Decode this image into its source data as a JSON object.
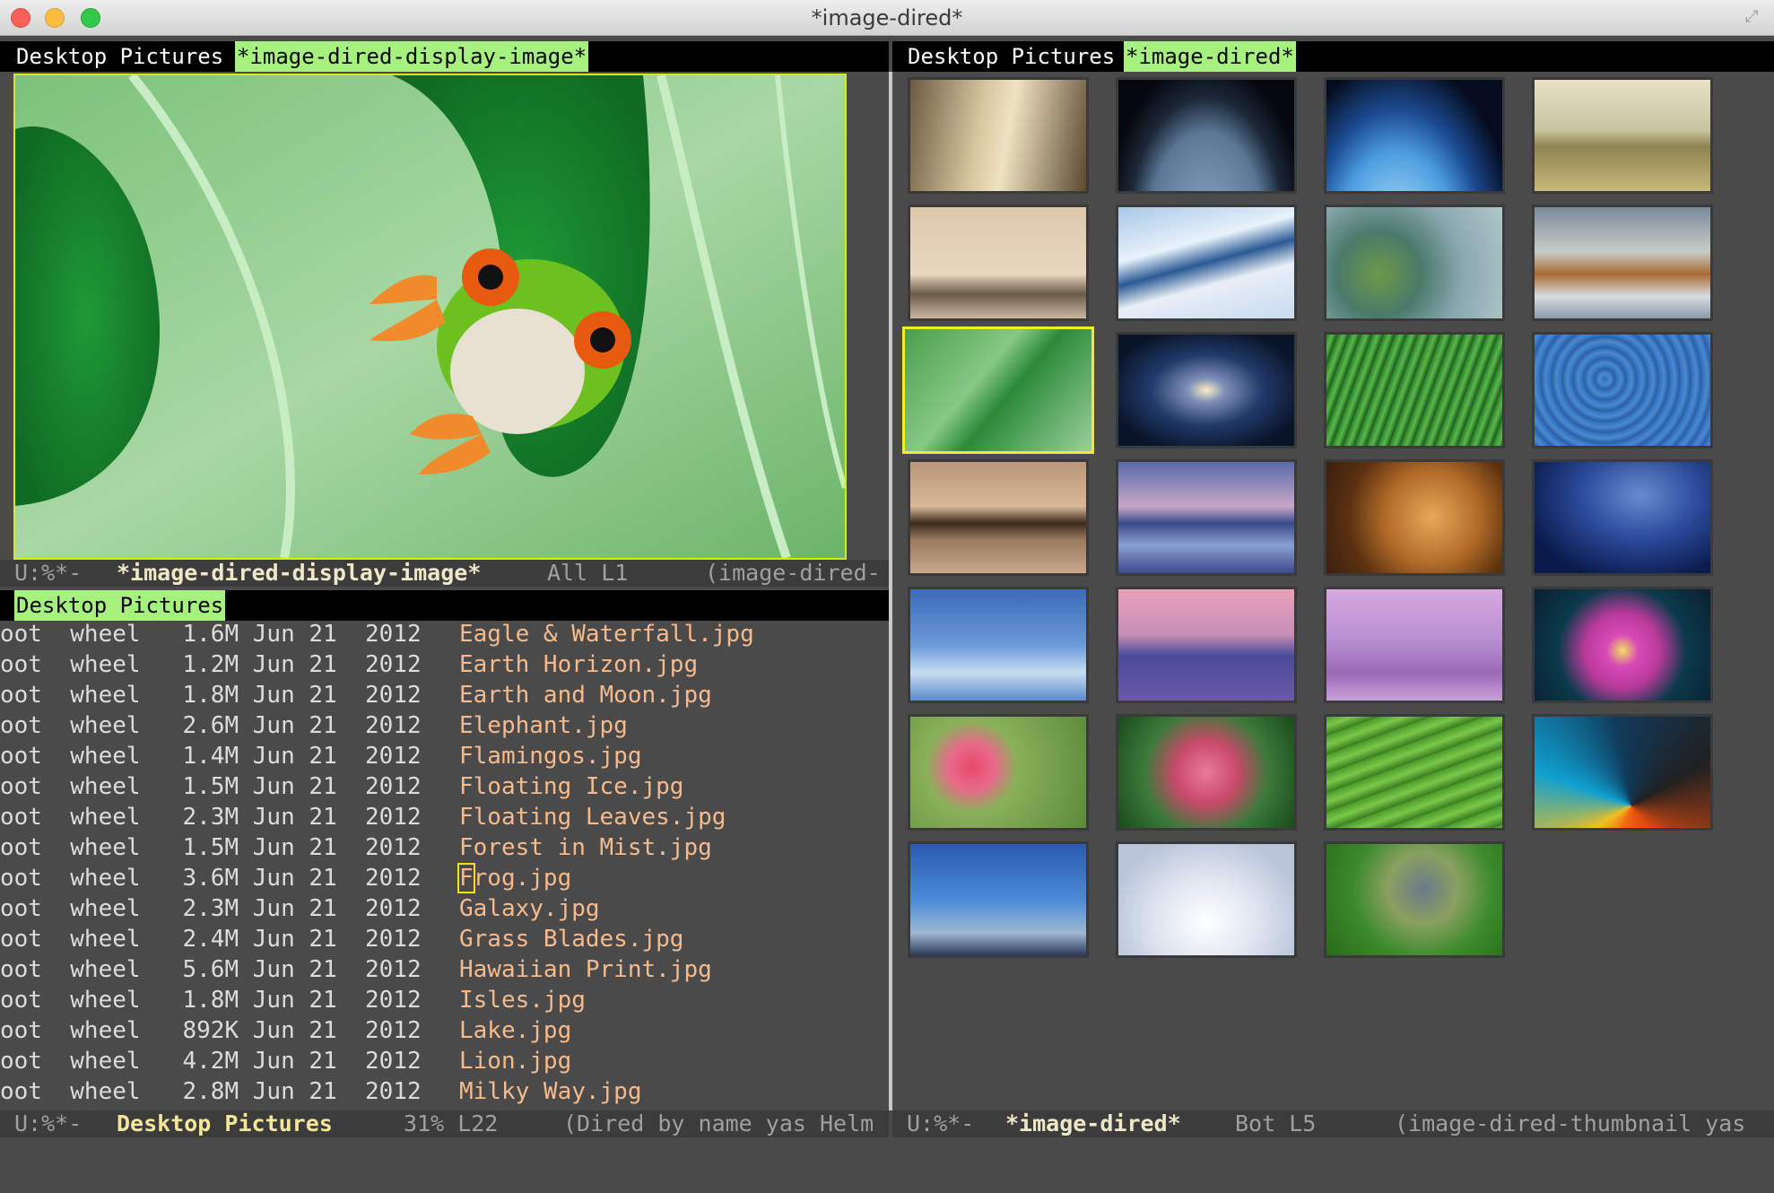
{
  "window": {
    "title": "*image-dired*"
  },
  "left_top_tabs": {
    "inactive": "Desktop Pictures",
    "active": "*image-dired-display-image*"
  },
  "right_tabs": {
    "inactive": "Desktop Pictures",
    "active": "*image-dired*"
  },
  "display_modeline": {
    "status": "U:%*-",
    "buffer": "*image-dired-display-image*",
    "position": "All L1",
    "mode": "(image-dired-"
  },
  "dired_header": "Desktop Pictures",
  "dired_rows": [
    {
      "meta": "oot  wheel   1.6M Jun 21  2012",
      "file": "Eagle & Waterfall.jpg"
    },
    {
      "meta": "oot  wheel   1.2M Jun 21  2012",
      "file": "Earth Horizon.jpg"
    },
    {
      "meta": "oot  wheel   1.8M Jun 21  2012",
      "file": "Earth and Moon.jpg"
    },
    {
      "meta": "oot  wheel   2.6M Jun 21  2012",
      "file": "Elephant.jpg"
    },
    {
      "meta": "oot  wheel   1.4M Jun 21  2012",
      "file": "Flamingos.jpg"
    },
    {
      "meta": "oot  wheel   1.5M Jun 21  2012",
      "file": "Floating Ice.jpg"
    },
    {
      "meta": "oot  wheel   2.3M Jun 21  2012",
      "file": "Floating Leaves.jpg"
    },
    {
      "meta": "oot  wheel   1.5M Jun 21  2012",
      "file": "Forest in Mist.jpg"
    },
    {
      "meta": "oot  wheel   3.6M Jun 21  2012",
      "file": "Frog.jpg"
    },
    {
      "meta": "oot  wheel   2.3M Jun 21  2012",
      "file": "Galaxy.jpg"
    },
    {
      "meta": "oot  wheel   2.4M Jun 21  2012",
      "file": "Grass Blades.jpg"
    },
    {
      "meta": "oot  wheel   5.6M Jun 21  2012",
      "file": "Hawaiian Print.jpg"
    },
    {
      "meta": "oot  wheel   1.8M Jun 21  2012",
      "file": "Isles.jpg"
    },
    {
      "meta": "oot  wheel   892K Jun 21  2012",
      "file": "Lake.jpg"
    },
    {
      "meta": "oot  wheel   4.2M Jun 21  2012",
      "file": "Lion.jpg"
    },
    {
      "meta": "oot  wheel   2.8M Jun 21  2012",
      "file": "Milky Way.jpg"
    }
  ],
  "dired_modeline": {
    "status": "U:%*-",
    "buffer": "Desktop Pictures",
    "position": "31% L22",
    "mode": "(Dired by name yas Helm"
  },
  "thumb_modeline": {
    "status": "U:%*-",
    "buffer": "*image-dired*",
    "position": "Bot L5",
    "mode": "(image-dired-thumbnail yas"
  },
  "selected_file": "Frog.jpg",
  "colors": {
    "active_tab": "#a6f27e",
    "file_name": "#f6ba8c",
    "selection": "#f4ec2a"
  },
  "thumbnails": [
    {
      "name": "eagle-waterfall",
      "bg": "linear-gradient(100deg,#6b5b40 0%,#d8c8a0 40%,#efe2c0 55%,#5a4a30 100%)"
    },
    {
      "name": "earth-horizon",
      "bg": "radial-gradient(ellipse at 50% 130%,#8aa4c2 0%,#5a7896 45%,#1c2838 62%,#05080e 80%)"
    },
    {
      "name": "earth-and-moon",
      "bg": "radial-gradient(ellipse at 40% 150%,#c8ecff 0%,#4c9ee0 40%,#1c4a90 58%,#050c1e 80%)"
    },
    {
      "name": "elephant",
      "bg": "linear-gradient(#e8e2c8 0%,#c8c4a0 45%,#8c8450 60%,#c8b878 100%)"
    },
    {
      "name": "flamingos",
      "bg": "linear-gradient(#ddc8ac 0%,#e8d8c0 60%,#6a5a4a 78%,#c8b8a0 100%)"
    },
    {
      "name": "floating-ice",
      "bg": "linear-gradient(165deg,#a8c8e8 0%,#e8f2fa 35%,#2a5a94 50%,#e8eef6 65%,#c8dcf0 100%)"
    },
    {
      "name": "floating-leaves",
      "bg": "radial-gradient(circle at 30% 60%,#6a9a4a 0%,#4a7a6a 30%,#8aa8b0 60%,#b0c8c8 100%)"
    },
    {
      "name": "forest-in-mist",
      "bg": "linear-gradient(#7a8a9a 0%,#c8ccc8 40%,#a86a34 60%,#d8dce0 80%,#8a9aa8 100%)"
    },
    {
      "name": "frog",
      "bg": "linear-gradient(130deg,#4aa04a 0%,#86c886 40%,#2a8a3a 55%,#9ad09a 100%)"
    },
    {
      "name": "galaxy",
      "bg": "radial-gradient(ellipse at 50% 50%,#f8f0c0 0%,#8090b8 15%,#203a6a 45%,#0a1428 80%)"
    },
    {
      "name": "grass-blades",
      "bg": "repeating-linear-gradient(110deg,#2a7a2a 0px,#5ab84a 6px,#1a5a1a 12px)"
    },
    {
      "name": "hawaiian-print",
      "bg": "repeating-radial-gradient(circle at 40% 40%,#2e6ab8 0px,#4a8ad0 6px,#2a5aa0 12px)"
    },
    {
      "name": "isles",
      "bg": "linear-gradient(#b8987a 0%,#d8b898 40%,#3a2a1a 55%,#9a7a60 70%,#c8a888 100%)"
    },
    {
      "name": "lake",
      "bg": "linear-gradient(#5a6aa8 0%,#c8a8c8 40%,#3a4a8a 55%,#8aa0d0 75%,#3a4a8a 100%)"
    },
    {
      "name": "lion",
      "bg": "radial-gradient(circle at 60% 50%,#e8a858 0%,#b06a28 40%,#5a3010 70%,#3a2010 100%)"
    },
    {
      "name": "milky-way",
      "bg": "radial-gradient(ellipse at 60% 30%,#6a8ad0 0%,#2a4a9a 40%,#0a1a4a 80%)"
    },
    {
      "name": "moon",
      "bg": "linear-gradient(#3a6ab8 0%,#6a9ad8 50%,#c8dcf0 75%,#5a8ac8 100%)"
    },
    {
      "name": "mountain-fuji",
      "bg": "linear-gradient(#e8a0b8 0%,#c890b8 40%,#4a4a9a 60%,#6a5aa8 100%)"
    },
    {
      "name": "purple-forest",
      "bg": "linear-gradient(#d8a8e0 0%,#b890d0 45%,#9a6ab8 75%,#c8a0d8 100%)"
    },
    {
      "name": "lotus",
      "bg": "radial-gradient(circle at 50% 55%,#f0e060 0%,#d84ab8 15%,#b83a9a 35%,#0a3a4a 60%,#0a2030 100%)"
    },
    {
      "name": "poppies",
      "bg": "radial-gradient(circle at 35% 45%,#e84a6a 0%,#e86a8a 18%,#8ab05a 35%,#5a8a3a 100%)"
    },
    {
      "name": "pink-berries",
      "bg": "radial-gradient(circle at 50% 50%,#e87a9a 0%,#c84a6a 30%,#3a7a3a 60%,#1a4a1a 100%)"
    },
    {
      "name": "rice-fields",
      "bg": "repeating-linear-gradient(160deg,#4a9a2a 0px,#7ac84a 10px,#3a7a20 20px)"
    },
    {
      "name": "abstract-shapes",
      "bg": "conic-gradient(from 200deg at 55% 80%,#f06a10 0deg,#f0c020 40deg,#10a0d0 90deg,#103a5a 150deg,#202020 220deg,#e04a10 300deg,#f06a10 360deg)"
    },
    {
      "name": "sky",
      "bg": "linear-gradient(#2a5ab0 0%,#4a8ad8 50%,#a0b8d0 80%,#2a3a5a 100%)"
    },
    {
      "name": "white-dunes",
      "bg": "radial-gradient(ellipse at 50% 70%,#ffffff 0%,#e0e6f0 40%,#b8c4d8 80%)"
    },
    {
      "name": "zebras",
      "bg": "radial-gradient(circle at 55% 40%,#6a7a8a 0%,#8aa060 30%,#3a8a2a 60%,#2a6a1a 100%)"
    }
  ]
}
